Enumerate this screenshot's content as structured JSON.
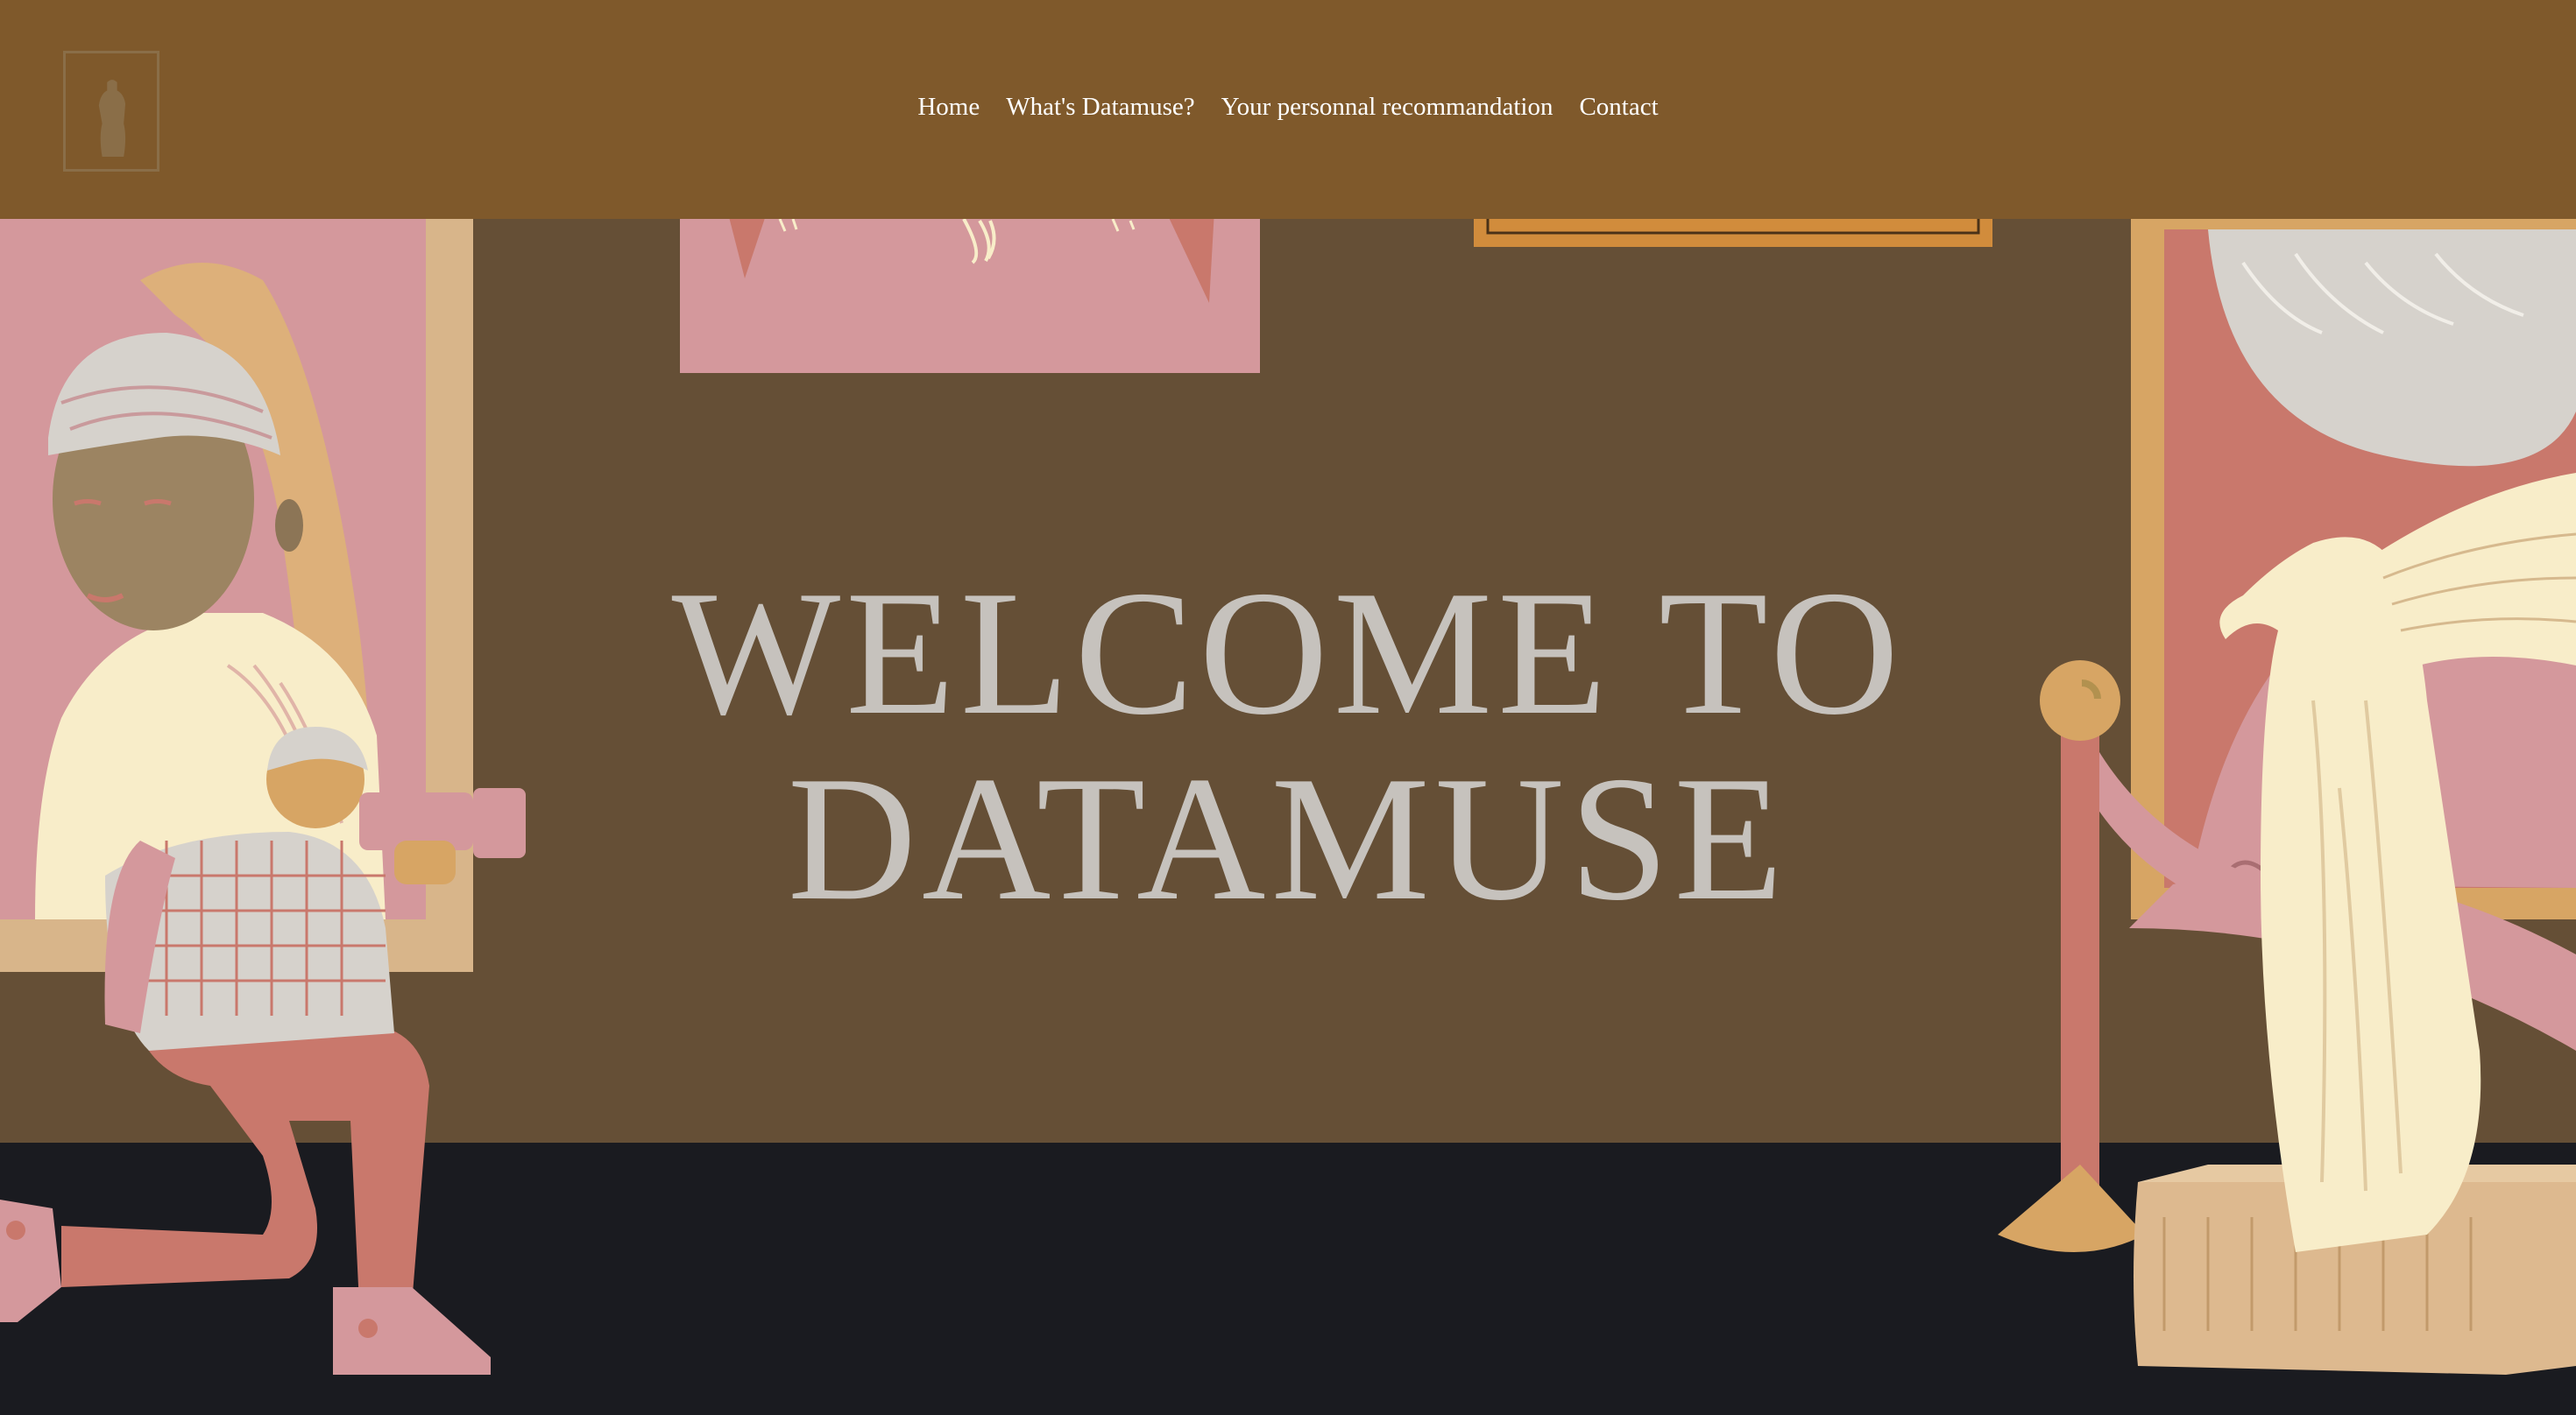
{
  "header": {
    "logo_icon": "statue-frame-icon",
    "nav": [
      {
        "label": "Home"
      },
      {
        "label": "What's Datamuse?"
      },
      {
        "label": "Your personnal recommandation"
      },
      {
        "label": "Contact"
      }
    ]
  },
  "hero": {
    "title_line1": "WELCOME TO",
    "title_line2": "DATAMUSE"
  },
  "colors": {
    "navbar": "#7f592b",
    "wall": "#654f36",
    "floor": "#1a1b20",
    "pink": "#d4989c",
    "salmon": "#c9786c",
    "cream": "#f8edc9",
    "gold": "#d7a564",
    "title": "#c6c2bd"
  }
}
